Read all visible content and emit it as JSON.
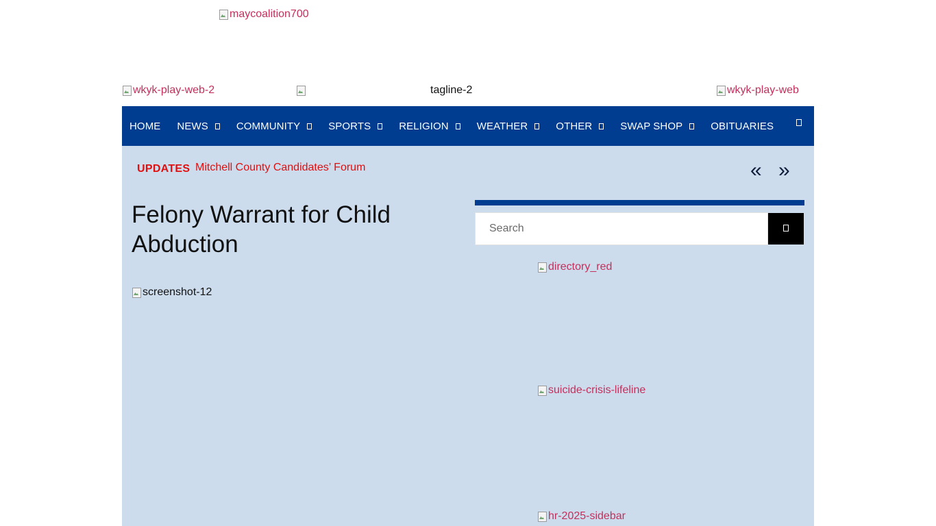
{
  "header": {
    "banner_ad_alt": "maycoalition700",
    "left_logo_alt": "wkyk-play-web-2",
    "tagline_alt": "tagline-2",
    "right_logo_alt": "wkyk-play-web"
  },
  "nav": {
    "items": [
      {
        "label": "HOME",
        "has_dropdown": false
      },
      {
        "label": "NEWS",
        "has_dropdown": true
      },
      {
        "label": "COMMUNITY",
        "has_dropdown": true
      },
      {
        "label": "SPORTS",
        "has_dropdown": true
      },
      {
        "label": "RELIGION",
        "has_dropdown": true
      },
      {
        "label": "WEATHER",
        "has_dropdown": true
      },
      {
        "label": "OTHER",
        "has_dropdown": true
      },
      {
        "label": "SWAP SHOP",
        "has_dropdown": true
      },
      {
        "label": "OBITUARIES",
        "has_dropdown": false
      }
    ],
    "search_icon": "search-icon",
    "background_color": "#003c8f"
  },
  "ticker": {
    "label": "UPDATES",
    "headline": "Mitchell County Candidates’ Forum",
    "prev_symbol": "«",
    "next_symbol": "»",
    "accent_color": "#e01010"
  },
  "article": {
    "title": "Felony Warrant for Child Abduction",
    "image_alt": "screenshot-12"
  },
  "sidebar": {
    "search_placeholder": "Search",
    "search_button_icon": "search-icon",
    "ads": [
      {
        "alt": "directory_red"
      },
      {
        "alt": "suicide-crisis-lifeline"
      },
      {
        "alt": "hr-2025-sidebar"
      }
    ]
  },
  "colors": {
    "content_background": "#ccdcec",
    "link_pink": "#c2305c"
  }
}
